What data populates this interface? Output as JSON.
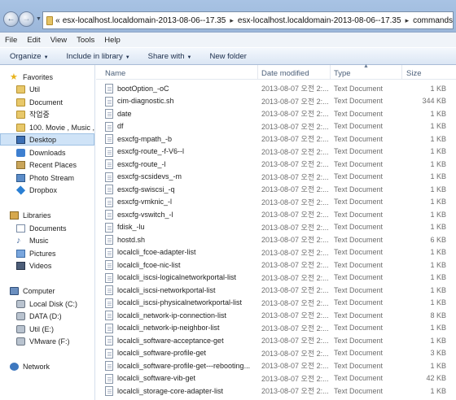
{
  "address": {
    "prefix": "«",
    "crumbs": [
      "esx-localhost.localdomain-2013-08-06--17.35",
      "esx-localhost.localdomain-2013-08-06--17.35",
      "commands"
    ],
    "separator": "▸"
  },
  "menu": [
    "File",
    "Edit",
    "View",
    "Tools",
    "Help"
  ],
  "toolbar": {
    "organize": "Organize",
    "include": "Include in library",
    "share": "Share with",
    "new_folder": "New folder"
  },
  "sidebar": {
    "favorites": {
      "header": "Favorites",
      "items": [
        "Util",
        "Document",
        "작업중",
        "100. Movie , Music ,",
        "Desktop",
        "Downloads",
        "Recent Places",
        "Photo Stream",
        "Dropbox"
      ]
    },
    "libraries": {
      "header": "Libraries",
      "items": [
        "Documents",
        "Music",
        "Pictures",
        "Videos"
      ]
    },
    "computer": {
      "header": "Computer",
      "items": [
        "Local Disk (C:)",
        "DATA (D:)",
        "Util (E:)",
        "VMware (F:)"
      ]
    },
    "network": {
      "header": "Network"
    },
    "selected": "Desktop"
  },
  "columns": {
    "name": "Name",
    "date": "Date modified",
    "type": "Type",
    "size": "Size"
  },
  "files": [
    {
      "name": "bootOption_-oC",
      "date": "2013-08-07 오전 2:...",
      "type": "Text Document",
      "size": "1 KB"
    },
    {
      "name": "cim-diagnostic.sh",
      "date": "2013-08-07 오전 2:...",
      "type": "Text Document",
      "size": "344 KB"
    },
    {
      "name": "date",
      "date": "2013-08-07 오전 2:...",
      "type": "Text Document",
      "size": "1 KB"
    },
    {
      "name": "df",
      "date": "2013-08-07 오전 2:...",
      "type": "Text Document",
      "size": "1 KB"
    },
    {
      "name": "esxcfg-mpath_-b",
      "date": "2013-08-07 오전 2:...",
      "type": "Text Document",
      "size": "1 KB"
    },
    {
      "name": "esxcfg-route_-f-V6--l",
      "date": "2013-08-07 오전 2:...",
      "type": "Text Document",
      "size": "1 KB"
    },
    {
      "name": "esxcfg-route_-l",
      "date": "2013-08-07 오전 2:...",
      "type": "Text Document",
      "size": "1 KB"
    },
    {
      "name": "esxcfg-scsidevs_-m",
      "date": "2013-08-07 오전 2:...",
      "type": "Text Document",
      "size": "1 KB"
    },
    {
      "name": "esxcfg-swiscsi_-q",
      "date": "2013-08-07 오전 2:...",
      "type": "Text Document",
      "size": "1 KB"
    },
    {
      "name": "esxcfg-vmknic_-l",
      "date": "2013-08-07 오전 2:...",
      "type": "Text Document",
      "size": "1 KB"
    },
    {
      "name": "esxcfg-vswitch_-l",
      "date": "2013-08-07 오전 2:...",
      "type": "Text Document",
      "size": "1 KB"
    },
    {
      "name": "fdisk_-lu",
      "date": "2013-08-07 오전 2:...",
      "type": "Text Document",
      "size": "1 KB"
    },
    {
      "name": "hostd.sh",
      "date": "2013-08-07 오전 2:...",
      "type": "Text Document",
      "size": "6 KB"
    },
    {
      "name": "localcli_fcoe-adapter-list",
      "date": "2013-08-07 오전 2:...",
      "type": "Text Document",
      "size": "1 KB"
    },
    {
      "name": "localcli_fcoe-nic-list",
      "date": "2013-08-07 오전 2:...",
      "type": "Text Document",
      "size": "1 KB"
    },
    {
      "name": "localcli_iscsi-logicalnetworkportal-list",
      "date": "2013-08-07 오전 2:...",
      "type": "Text Document",
      "size": "1 KB"
    },
    {
      "name": "localcli_iscsi-networkportal-list",
      "date": "2013-08-07 오전 2:...",
      "type": "Text Document",
      "size": "1 KB"
    },
    {
      "name": "localcli_iscsi-physicalnetworkportal-list",
      "date": "2013-08-07 오전 2:...",
      "type": "Text Document",
      "size": "1 KB"
    },
    {
      "name": "localcli_network-ip-connection-list",
      "date": "2013-08-07 오전 2:...",
      "type": "Text Document",
      "size": "8 KB"
    },
    {
      "name": "localcli_network-ip-neighbor-list",
      "date": "2013-08-07 오전 2:...",
      "type": "Text Document",
      "size": "1 KB"
    },
    {
      "name": "localcli_software-acceptance-get",
      "date": "2013-08-07 오전 2:...",
      "type": "Text Document",
      "size": "1 KB"
    },
    {
      "name": "localcli_software-profile-get",
      "date": "2013-08-07 오전 2:...",
      "type": "Text Document",
      "size": "3 KB"
    },
    {
      "name": "localcli_software-profile-get---rebooting...",
      "date": "2013-08-07 오전 2:...",
      "type": "Text Document",
      "size": "1 KB"
    },
    {
      "name": "localcli_software-vib-get",
      "date": "2013-08-07 오전 2:...",
      "type": "Text Document",
      "size": "42 KB"
    },
    {
      "name": "localcli_storage-core-adapter-list",
      "date": "2013-08-07 오전 2:...",
      "type": "Text Document",
      "size": "1 KB"
    }
  ]
}
